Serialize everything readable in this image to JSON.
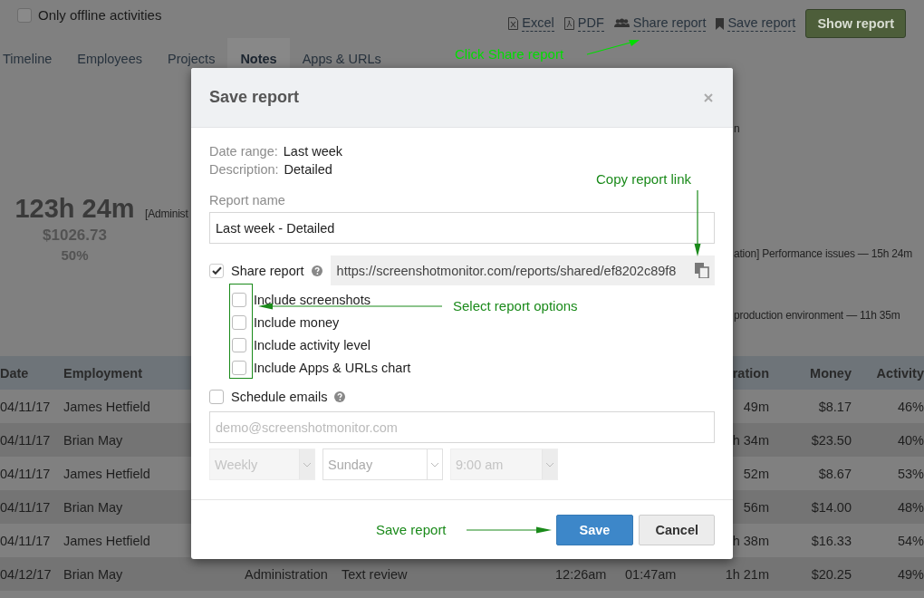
{
  "top_bar": {
    "offline_filter": {
      "label": "Only offline activities",
      "checked": false
    },
    "export_links": [
      {
        "label": "Excel",
        "kind": "excel"
      },
      {
        "label": "PDF",
        "kind": "pdf"
      },
      {
        "label": "Share report",
        "kind": "share"
      },
      {
        "label": "Save report",
        "kind": "save"
      }
    ],
    "show_report_button": "Show report"
  },
  "tabs": [
    {
      "label": "Timeline",
      "selected": false
    },
    {
      "label": "Employees",
      "selected": false
    },
    {
      "label": "Projects",
      "selected": false
    },
    {
      "label": "Notes",
      "selected": true
    },
    {
      "label": "Apps & URLs",
      "selected": false
    }
  ],
  "summary": {
    "total_time": "123h 24m",
    "money": "$1026.73",
    "activity": "50%"
  },
  "note_labels": [
    "n",
    "[Administ",
    "ation] Performance issues — 15h 24m",
    "production environment — 11h 35m"
  ],
  "table": {
    "columns": [
      "Date",
      "Employment",
      "ration",
      "Money",
      "Activity"
    ],
    "rows": [
      {
        "date": "04/11/17",
        "employment": "James Hetfield",
        "duration": "49m",
        "money": "$8.17",
        "activity": "46%"
      },
      {
        "date": "04/11/17",
        "employment": "Brian May",
        "duration": "h 34m",
        "money": "$23.50",
        "activity": "40%"
      },
      {
        "date": "04/11/17",
        "employment": "James Hetfield",
        "duration": "52m",
        "money": "$8.67",
        "activity": "53%"
      },
      {
        "date": "04/11/17",
        "employment": "Brian May",
        "duration": "56m",
        "money": "$14.00",
        "activity": "48%"
      },
      {
        "date": "04/11/17",
        "employment": "James Hetfield",
        "duration": "h 38m",
        "money": "$16.33",
        "activity": "54%"
      },
      {
        "date": "04/12/17",
        "employment": "Brian May",
        "column_3": "Administration",
        "column_4": "Text review",
        "column_5": "12:26am",
        "column_6": "01:47am",
        "duration": "1h 21m",
        "money": "$20.25",
        "activity": "49%"
      }
    ]
  },
  "dialog": {
    "title": "Save report",
    "details": [
      {
        "label": "Date range:",
        "value": "Last week"
      },
      {
        "label": "Description:",
        "value": "Detailed"
      }
    ],
    "report_name": {
      "label": "Report name",
      "value": "Last week - Detailed"
    },
    "share_report": {
      "label": "Share report",
      "checked": true,
      "url": "https://screenshotmonitor.com/reports/shared/ef8202c89f8"
    },
    "options": [
      {
        "label": "Include screenshots",
        "checked": false
      },
      {
        "label": "Include money",
        "checked": false
      },
      {
        "label": "Include activity level",
        "checked": false
      },
      {
        "label": "Include Apps & URLs chart",
        "checked": false
      }
    ],
    "schedule_emails": {
      "label": "Schedule emails",
      "checked": false
    },
    "email": {
      "placeholder": "demo@screenshotmonitor.com"
    },
    "selects": [
      {
        "value": "Weekly",
        "disabled": true
      },
      {
        "value": "Sunday",
        "disabled": false
      },
      {
        "value": "9:00 am",
        "disabled": true
      }
    ],
    "buttons": [
      {
        "label": "Save",
        "kind": "primary"
      },
      {
        "label": "Cancel",
        "kind": "default"
      }
    ]
  },
  "annotations": [
    {
      "text": "Click Share report",
      "color": "#00dd00"
    },
    {
      "text": "Copy report link",
      "color": "#1a8a1a"
    },
    {
      "text": "Select report options",
      "color": "#1a8a1a"
    },
    {
      "text": "Save report",
      "color": "#1a8a1a"
    }
  ]
}
